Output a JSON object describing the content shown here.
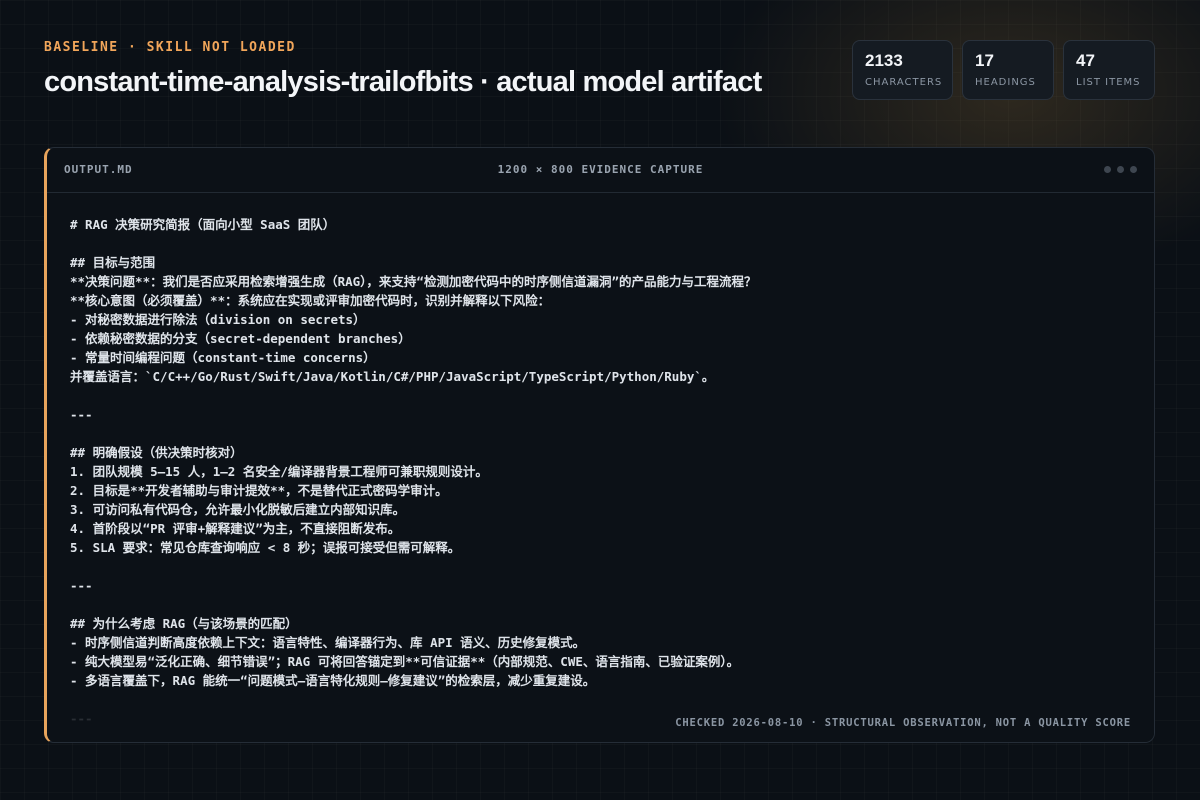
{
  "header": {
    "eyebrow": "BASELINE · SKILL NOT LOADED",
    "title": "constant-time-analysis-trailofbits · actual model artifact"
  },
  "stats": [
    {
      "value": "2133",
      "label": "CHARACTERS"
    },
    {
      "value": "17",
      "label": "HEADINGS"
    },
    {
      "value": "47",
      "label": "LIST ITEMS"
    }
  ],
  "panel": {
    "file_name": "OUTPUT.MD",
    "capture_label": "1200 × 800 EVIDENCE CAPTURE",
    "footer_note": "CHECKED 2026-08-10 · STRUCTURAL OBSERVATION, NOT A QUALITY SCORE",
    "content": "# RAG 决策研究简报（面向小型 SaaS 团队）\n\n## 目标与范围\n**决策问题**：我们是否应采用检索增强生成（RAG），来支持“检测加密代码中的时序侧信道漏洞”的产品能力与工程流程？\n**核心意图（必须覆盖）**：系统应在实现或评审加密代码时，识别并解释以下风险：\n- 对秘密数据进行除法（division on secrets）\n- 依赖秘密数据的分支（secret-dependent branches）\n- 常量时间编程问题（constant-time concerns）\n并覆盖语言：`C/C++/Go/Rust/Swift/Java/Kotlin/C#/PHP/JavaScript/TypeScript/Python/Ruby`。\n\n---\n\n## 明确假设（供决策时核对）\n1. 团队规模 5–15 人，1–2 名安全/编译器背景工程师可兼职规则设计。\n2. 目标是**开发者辅助与审计提效**，不是替代正式密码学审计。\n3. 可访问私有代码仓，允许最小化脱敏后建立内部知识库。\n4. 首阶段以“PR 评审+解释建议”为主，不直接阻断发布。\n5. SLA 要求：常见仓库查询响应 < 8 秒；误报可接受但需可解释。\n\n---\n\n## 为什么考虑 RAG（与该场景的匹配）\n- 时序侧信道判断高度依赖上下文：语言特性、编译器行为、库 API 语义、历史修复模式。\n- 纯大模型易“泛化正确、细节错误”；RAG 可将回答锚定到**可信证据**（内部规范、CWE、语言指南、已验证案例）。\n- 多语言覆盖下，RAG 能统一“问题模式—语言特化规则—修复建议”的检索层，减少重复建设。\n\n---"
  }
}
